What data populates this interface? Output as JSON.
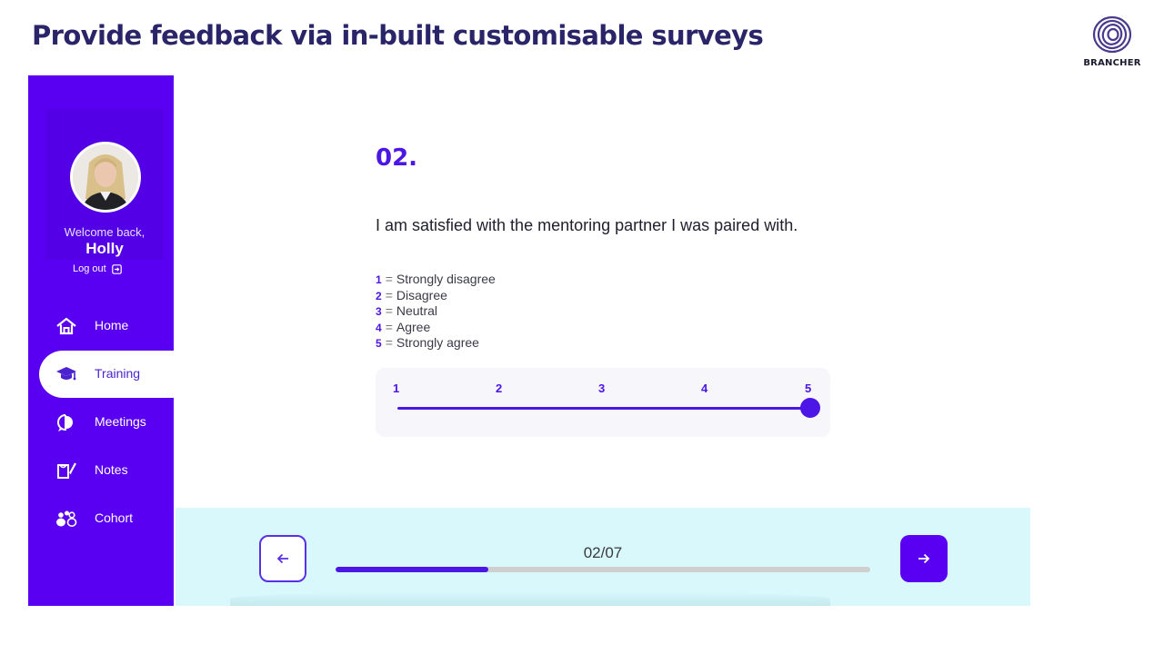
{
  "slide": {
    "title": "Provide feedback via in-built customisable surveys",
    "logo_text": "BRANCHER"
  },
  "sidebar": {
    "welcome": "Welcome back,",
    "user_name": "Holly",
    "logout_label": "Log out",
    "items": [
      {
        "label": "Home",
        "icon": "home-icon",
        "active": false
      },
      {
        "label": "Training",
        "icon": "graduation-cap-icon",
        "active": true
      },
      {
        "label": "Meetings",
        "icon": "chat-bubbles-icon",
        "active": false
      },
      {
        "label": "Notes",
        "icon": "notes-pencil-icon",
        "active": false
      },
      {
        "label": "Cohort",
        "icon": "people-group-icon",
        "active": false
      }
    ]
  },
  "question": {
    "number": "02.",
    "text": "I am satisfied with the mentoring partner I was paired with.",
    "scale_legend": [
      {
        "value": "1",
        "label": "Strongly disagree"
      },
      {
        "value": "2",
        "label": "Disagree"
      },
      {
        "value": "3",
        "label": "Neutral"
      },
      {
        "value": "4",
        "label": "Agree"
      },
      {
        "value": "5",
        "label": "Strongly agree"
      }
    ],
    "scale_ticks": [
      "1",
      "2",
      "3",
      "4",
      "5"
    ],
    "selected_value": 5
  },
  "footer": {
    "progress_label": "02/07",
    "progress_fraction": 0.286,
    "prev_icon": "arrow-left-icon",
    "next_icon": "arrow-right-icon"
  },
  "colors": {
    "sidebar": "#5a00f2",
    "accent": "#4b16e6",
    "title": "#2a2468",
    "footer_bg": "#d8f8fc"
  }
}
